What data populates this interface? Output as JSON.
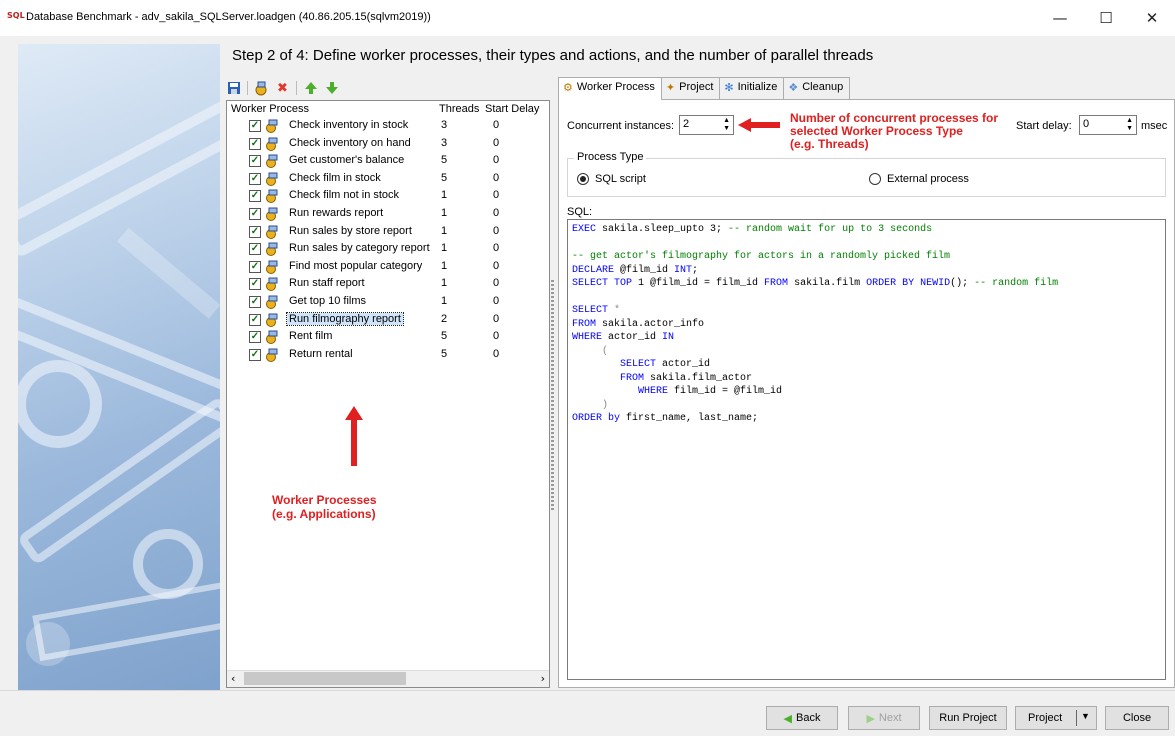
{
  "window": {
    "app_icon": "SQL",
    "title": "Database Benchmark - adv_sakila_SQLServer.loadgen (40.86.205.15(sqlvm2019))",
    "minimize": "—",
    "maximize": "☐",
    "close": "✕"
  },
  "step_title": "Step 2 of 4:  Define worker processes, their types and actions, and the number of parallel threads",
  "toolbar": {
    "icons": [
      "save-icon",
      "add-process-icon",
      "delete-icon",
      "move-up-icon",
      "move-down-icon"
    ]
  },
  "worker_list": {
    "headers": {
      "process": "Worker Process",
      "threads": "Threads",
      "delay": "Start Delay"
    },
    "rows": [
      {
        "name": "Check inventory in stock",
        "threads": "3",
        "delay": "0"
      },
      {
        "name": "Check inventory on hand",
        "threads": "3",
        "delay": "0"
      },
      {
        "name": "Get customer's balance",
        "threads": "5",
        "delay": "0"
      },
      {
        "name": "Check film in stock",
        "threads": "5",
        "delay": "0"
      },
      {
        "name": "Check film not in stock",
        "threads": "1",
        "delay": "0"
      },
      {
        "name": "Run rewards report",
        "threads": "1",
        "delay": "0"
      },
      {
        "name": "Run sales by store report",
        "threads": "1",
        "delay": "0"
      },
      {
        "name": "Run sales by category report",
        "threads": "1",
        "delay": "0"
      },
      {
        "name": "Find most popular category",
        "threads": "1",
        "delay": "0"
      },
      {
        "name": "Run staff report",
        "threads": "1",
        "delay": "0"
      },
      {
        "name": "Get top 10 films",
        "threads": "1",
        "delay": "0"
      },
      {
        "name": "Run filmography report",
        "threads": "2",
        "delay": "0"
      },
      {
        "name": "Rent film",
        "threads": "5",
        "delay": "0"
      },
      {
        "name": "Return rental",
        "threads": "5",
        "delay": "0"
      }
    ],
    "selected_row": "Run filmography report"
  },
  "annotation_left": [
    "Worker Processes",
    "(e.g. Applications)"
  ],
  "annotation_right": [
    "Number of concurrent processes for",
    "selected Worker Process Type",
    "(e.g. Threads)"
  ],
  "tabs": [
    "Worker Process",
    "Project",
    "Initialize",
    "Cleanup"
  ],
  "worker_process": {
    "concurrent_label": "Concurrent instances:",
    "concurrent_value": "2",
    "start_delay_label": "Start delay:",
    "start_delay_value": "0",
    "start_delay_unit": "msec",
    "process_type_label": "Process Type",
    "sql_script_label": "SQL script",
    "external_label": "External process",
    "sql_label": "SQL:"
  },
  "sql_lines": [
    [
      [
        "kw",
        "EXEC"
      ],
      [
        "nm",
        " sakila.sleep_upto 3; "
      ],
      [
        "cm",
        "-- random wait for up to 3 seconds"
      ]
    ],
    [],
    [
      [
        "cm",
        "-- get actor's filmography for actors in a randomly picked film"
      ]
    ],
    [
      [
        "kw",
        "DECLARE"
      ],
      [
        "nm",
        " @film_id "
      ],
      [
        "kw",
        "INT"
      ],
      [
        "nm",
        ";"
      ]
    ],
    [
      [
        "kw",
        "SELECT TOP"
      ],
      [
        "nm",
        " 1 @film_id = film_id "
      ],
      [
        "kw",
        "FROM"
      ],
      [
        "nm",
        " sakila.film "
      ],
      [
        "kw",
        "ORDER BY NEWID"
      ],
      [
        "nm",
        "(); "
      ],
      [
        "cm",
        "-- random film"
      ]
    ],
    [],
    [
      [
        "kw",
        "SELECT"
      ],
      [
        "op",
        " *"
      ]
    ],
    [
      [
        "kw",
        "FROM"
      ],
      [
        "nm",
        " sakila.actor_info"
      ]
    ],
    [
      [
        "kw",
        "WHERE"
      ],
      [
        "nm",
        " actor_id "
      ],
      [
        "kw",
        "IN"
      ]
    ],
    [
      [
        "op",
        "     ("
      ]
    ],
    [
      [
        "nm",
        "        "
      ],
      [
        "kw",
        "SELECT"
      ],
      [
        "nm",
        " actor_id"
      ]
    ],
    [
      [
        "nm",
        "        "
      ],
      [
        "kw",
        "FROM"
      ],
      [
        "nm",
        " sakila.film_actor"
      ]
    ],
    [
      [
        "nm",
        "           "
      ],
      [
        "kw",
        "WHERE"
      ],
      [
        "nm",
        " film_id = @film_id"
      ]
    ],
    [
      [
        "op",
        "     )"
      ]
    ],
    [
      [
        "kw",
        "ORDER by"
      ],
      [
        "nm",
        " first_name, last_name;"
      ]
    ]
  ],
  "buttons": {
    "back": "Back",
    "next": "Next",
    "run_project": "Run Project",
    "project": "Project",
    "close": "Close"
  }
}
